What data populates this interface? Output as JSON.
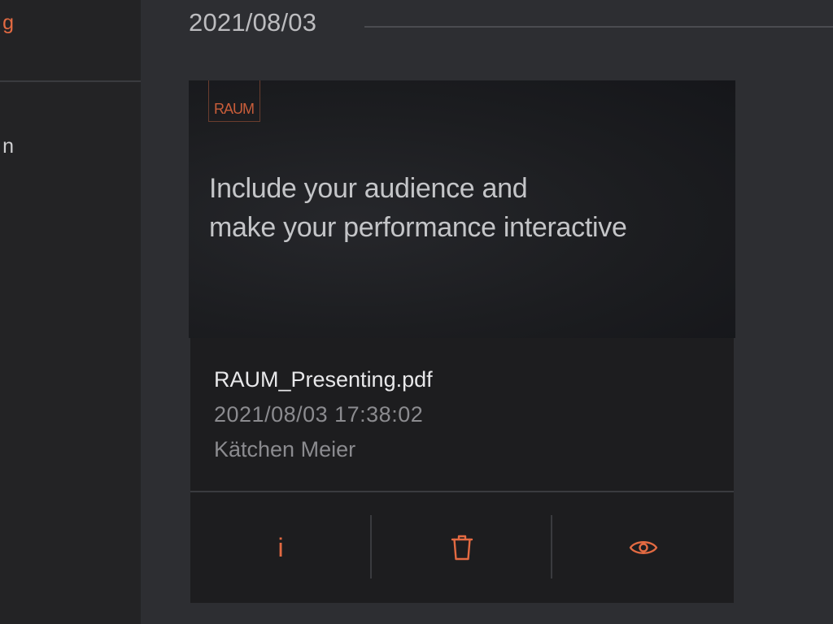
{
  "sidebar": {
    "items": [
      {
        "label": "g",
        "active": true
      },
      {
        "label": "n",
        "active": false
      }
    ]
  },
  "section": {
    "date": "2021/08/03"
  },
  "file": {
    "thumbnail": {
      "logo": "RAUM",
      "line1": "Include your audience and",
      "line2": "make your performance interactive"
    },
    "name": "RAUM_Presenting.pdf",
    "datetime": "2021/08/03 17:38:02",
    "user": "Kätchen Meier"
  },
  "actions": {
    "info_glyph": "i",
    "icons": [
      "info-icon",
      "trash-icon",
      "eye-icon"
    ]
  },
  "colors": {
    "accent": "#e36a42",
    "background": "#2d2e32",
    "sidebar": "#232325",
    "card": "#1d1d1f"
  }
}
